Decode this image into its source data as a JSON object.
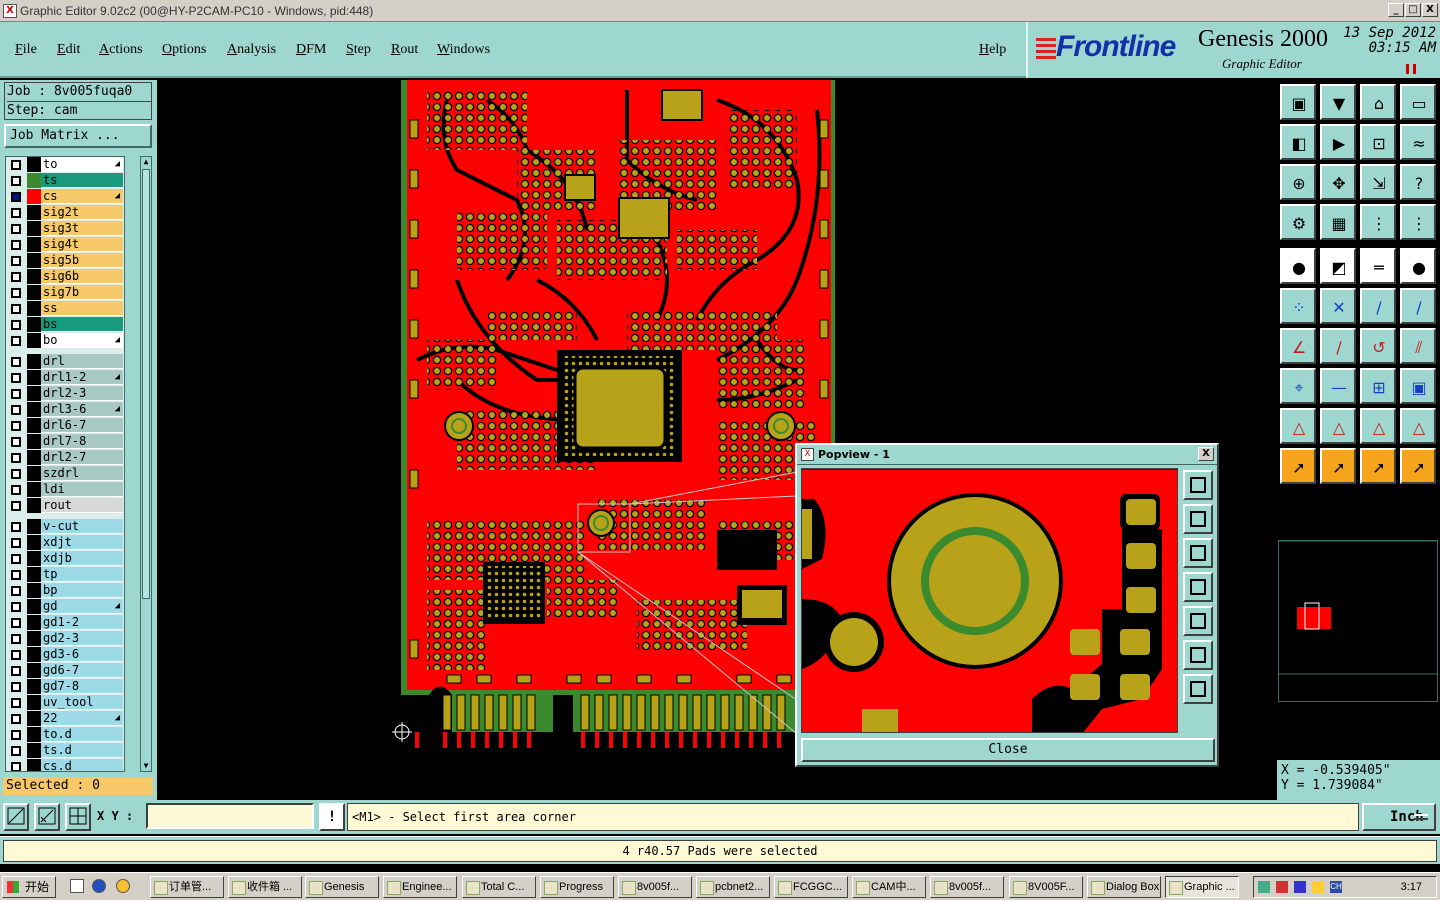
{
  "window": {
    "title": "Graphic Editor 9.02c2 (00@HY-P2CAM-PC10 - Windows, pid:448)",
    "minimize": "_",
    "maximize": "□",
    "close": "X"
  },
  "menu": [
    "File",
    "Edit",
    "Actions",
    "Options",
    "Analysis",
    "DFM",
    "Step",
    "Rout",
    "Windows"
  ],
  "help": "Help",
  "brand": {
    "logo": "Frontline",
    "product": "Genesis 2000",
    "subtitle": "Graphic Editor",
    "date": "13 Sep 2012",
    "time": "03:15 AM"
  },
  "job": {
    "job_line": "Job : 8v005fuqa0",
    "step_line": "Step: cam",
    "matrix_button": "Job Matrix ..."
  },
  "layers": [
    {
      "name": "to",
      "row_bg": "#ffffff",
      "swatch": "#000000",
      "checked": false,
      "edit": true
    },
    {
      "name": "ts",
      "row_bg": "#199a7c",
      "swatch": "#3b8a2d",
      "checked": false,
      "edit": false
    },
    {
      "name": "cs",
      "row_bg": "#f5c96a",
      "swatch": "#ff0000",
      "checked": true,
      "edit": true
    },
    {
      "name": "sig2t",
      "row_bg": "#f5c96a",
      "swatch": "#000000",
      "checked": false,
      "edit": false
    },
    {
      "name": "sig3t",
      "row_bg": "#f5c96a",
      "swatch": "#000000",
      "checked": false,
      "edit": false
    },
    {
      "name": "sig4t",
      "row_bg": "#f5c96a",
      "swatch": "#000000",
      "checked": false,
      "edit": false
    },
    {
      "name": "sig5b",
      "row_bg": "#f5c96a",
      "swatch": "#000000",
      "checked": false,
      "edit": false
    },
    {
      "name": "sig6b",
      "row_bg": "#f5c96a",
      "swatch": "#000000",
      "checked": false,
      "edit": false
    },
    {
      "name": "sig7b",
      "row_bg": "#f5c96a",
      "swatch": "#000000",
      "checked": false,
      "edit": false
    },
    {
      "name": "ss",
      "row_bg": "#f5c96a",
      "swatch": "#000000",
      "checked": false,
      "edit": false
    },
    {
      "name": "bs",
      "row_bg": "#199a7c",
      "swatch": "#000000",
      "checked": false,
      "edit": false
    },
    {
      "name": "bo",
      "row_bg": "#ffffff",
      "swatch": "#000000",
      "checked": false,
      "edit": true
    },
    {
      "gap": true
    },
    {
      "name": "drl",
      "row_bg": "#a8c8c4",
      "swatch": "#000000",
      "checked": false,
      "edit": false
    },
    {
      "name": "drl1-2",
      "row_bg": "#a8c8c4",
      "swatch": "#000000",
      "checked": false,
      "edit": true
    },
    {
      "name": "drl2-3",
      "row_bg": "#a8c8c4",
      "swatch": "#000000",
      "checked": false,
      "edit": false
    },
    {
      "name": "drl3-6",
      "row_bg": "#a8c8c4",
      "swatch": "#000000",
      "checked": false,
      "edit": true
    },
    {
      "name": "drl6-7",
      "row_bg": "#a8c8c4",
      "swatch": "#000000",
      "checked": false,
      "edit": false
    },
    {
      "name": "drl7-8",
      "row_bg": "#a8c8c4",
      "swatch": "#000000",
      "checked": false,
      "edit": false
    },
    {
      "name": "drl2-7",
      "row_bg": "#a8c8c4",
      "swatch": "#000000",
      "checked": false,
      "edit": false
    },
    {
      "name": "szdrl",
      "row_bg": "#a8c8c4",
      "swatch": "#000000",
      "checked": false,
      "edit": false
    },
    {
      "name": "ldi",
      "row_bg": "#a8c8c4",
      "swatch": "#000000",
      "checked": false,
      "edit": false
    },
    {
      "name": "rout",
      "row_bg": "#d8d8d8",
      "swatch": "#000000",
      "checked": false,
      "edit": false
    },
    {
      "gap": true
    },
    {
      "name": "v-cut",
      "row_bg": "#9ed9e8",
      "swatch": "#000000",
      "checked": false,
      "edit": false
    },
    {
      "name": "xdjt",
      "row_bg": "#9ed9e8",
      "swatch": "#000000",
      "checked": false,
      "edit": false
    },
    {
      "name": "xdjb",
      "row_bg": "#9ed9e8",
      "swatch": "#000000",
      "checked": false,
      "edit": false
    },
    {
      "name": "tp",
      "row_bg": "#9ed9e8",
      "swatch": "#000000",
      "checked": false,
      "edit": false
    },
    {
      "name": "bp",
      "row_bg": "#9ed9e8",
      "swatch": "#000000",
      "checked": false,
      "edit": false
    },
    {
      "name": "gd",
      "row_bg": "#9ed9e8",
      "swatch": "#000000",
      "checked": false,
      "edit": true
    },
    {
      "name": "gd1-2",
      "row_bg": "#9ed9e8",
      "swatch": "#000000",
      "checked": false,
      "edit": false
    },
    {
      "name": "gd2-3",
      "row_bg": "#9ed9e8",
      "swatch": "#000000",
      "checked": false,
      "edit": false
    },
    {
      "name": "gd3-6",
      "row_bg": "#9ed9e8",
      "swatch": "#000000",
      "checked": false,
      "edit": false
    },
    {
      "name": "gd6-7",
      "row_bg": "#9ed9e8",
      "swatch": "#000000",
      "checked": false,
      "edit": false
    },
    {
      "name": "gd7-8",
      "row_bg": "#9ed9e8",
      "swatch": "#000000",
      "checked": false,
      "edit": false
    },
    {
      "name": "uv_tool",
      "row_bg": "#9ed9e8",
      "swatch": "#000000",
      "checked": false,
      "edit": false
    },
    {
      "name": "22",
      "row_bg": "#9ed9e8",
      "swatch": "#000000",
      "checked": false,
      "edit": true
    },
    {
      "name": "to.d",
      "row_bg": "#9ed9e8",
      "swatch": "#000000",
      "checked": false,
      "edit": false
    },
    {
      "name": "ts.d",
      "row_bg": "#9ed9e8",
      "swatch": "#000000",
      "checked": false,
      "edit": false
    },
    {
      "name": "cs.d",
      "row_bg": "#9ed9e8",
      "swatch": "#000000",
      "checked": false,
      "edit": false
    }
  ],
  "selected": "Selected : 0",
  "coords": {
    "x": "X = -0.539405\"",
    "y": "Y =  1.739084\""
  },
  "cmd": {
    "xy_label": "X Y :",
    "xy_value": "",
    "bang": "!",
    "prompt": "<M1> - Select first area corner",
    "unit": "Inch"
  },
  "status": "4 r40.57 Pads were selected",
  "popview": {
    "title": "Popview - 1",
    "close": "Close"
  },
  "taskbar": {
    "start": "开始",
    "items": [
      "订单管...",
      "收件箱 ...",
      "Genesis",
      "Enginee...",
      "Total C...",
      "Progress",
      "8v005f...",
      "pcbnet2...",
      "FCGGC...",
      "CAM中...",
      "8v005f...",
      "8V005F...",
      "Dialog Box",
      "Graphic ..."
    ],
    "active_index": 13,
    "clock": "3:17"
  },
  "colors": {
    "panel": "#9dd7d0",
    "copper": "#ff0000",
    "pad": "#b8a21a",
    "mask": "#3b8a2d"
  }
}
